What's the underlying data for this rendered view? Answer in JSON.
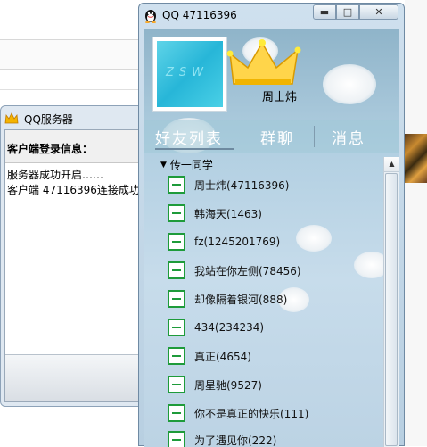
{
  "server_window": {
    "title": "QQ服务器",
    "header_label": "客户端登录信息：",
    "log_lines": [
      "服务器成功开启……",
      "客户端 47116396连接成功"
    ]
  },
  "qq_window": {
    "title": "QQ  47116396",
    "controls": {
      "minimize": "▬",
      "maximize": "□",
      "close": "✕"
    },
    "avatar_text": "ZSW",
    "username": "周士炜",
    "tabs": [
      "好友列表",
      "群聊",
      "消息"
    ],
    "group_name": "传一同学",
    "friends": [
      "周士炜(47116396)",
      "韩海天(1463)",
      "fz(1245201769)",
      "我站在你左侧(78456)",
      "却像隔着银河(888)",
      "434(234234)",
      "真正(4654)",
      "周星驰(9527)",
      "你不是真正的快乐(111)",
      "为了遇见你(222)"
    ],
    "colors": {
      "friend_icon": "#1e9b3a",
      "tab_text": "#ffffff"
    }
  }
}
